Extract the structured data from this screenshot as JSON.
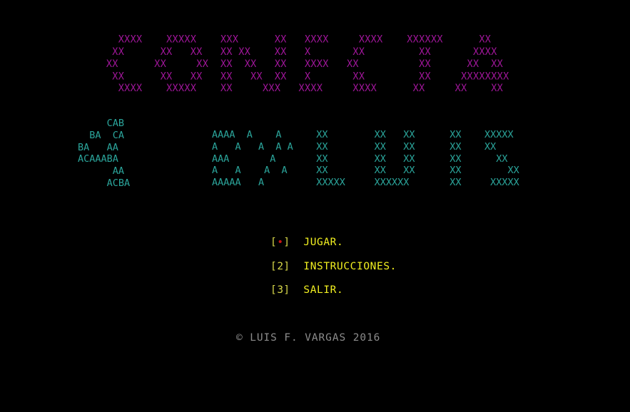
{
  "title_art": [
    "    XXXX    XXXXX    XXX      XX   XXXX     XXXX    XXXXXX      XX",
    "   XX      XX   XX   XX XX    XX   X       XX         XX       XXXX",
    "  XX      XX     XX  XX  XX   XX   XXXX   XX          XX      XX  XX",
    "   XX      XX   XX   XX   XX  XX   X       XX         XX     XXXXXXXX",
    "    XXXX    XXXXX    XX     XXX   XXXX     XXXX      XX     XX    XX"
  ],
  "subtitle_left_art": [
    "     CAB",
    "  BA  CA",
    "BA   AA",
    "ACAAABA",
    "      AA",
    "     ACBA"
  ],
  "subtitle_right_art": [
    "AAAA  A    A      XX        XX   XX      XX    XXXXX",
    "A   A   A  A A    XX        XX   XX      XX    XX",
    "AAA       A       XX        XX   XX      XX      XX",
    "A   A    A  A     XX        XX   XX      XX        XX",
    "AAAAA   A         XXXXX     XXXXXX       XX     XXXXX"
  ],
  "menu": {
    "jugar": {
      "open": "[",
      "key": "•",
      "close": "]",
      "label": "JUGAR."
    },
    "instrucciones": {
      "open": "[",
      "key": "2",
      "close": "]",
      "label": "INSTRUCCIONES."
    },
    "salir": {
      "open": "[",
      "key": "3",
      "close": "]",
      "label": "SALIR."
    }
  },
  "copyright": "© LUIS F. VARGAS 2016",
  "colors": {
    "background": "#000000",
    "title": "#a0169a",
    "subtitle": "#2ba59b",
    "menu_label": "#f2f020",
    "selected_marker": "#c81414",
    "copyright": "#8c8c8c"
  }
}
